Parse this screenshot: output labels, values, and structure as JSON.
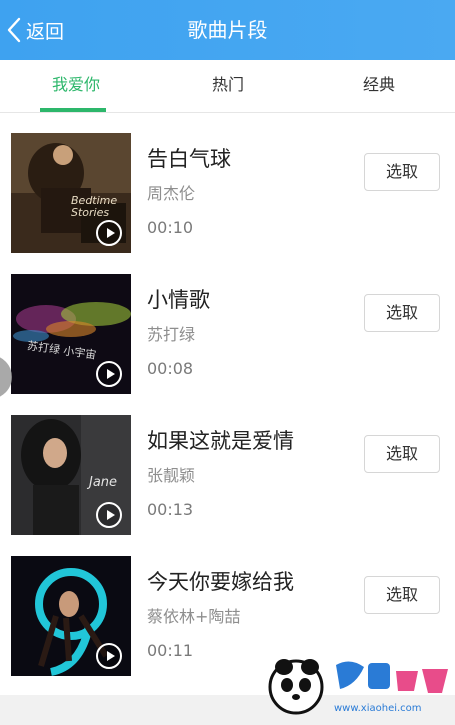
{
  "header": {
    "back_label": "返回",
    "title": "歌曲片段"
  },
  "tabs": [
    {
      "label": "我爱你",
      "active": true
    },
    {
      "label": "热门",
      "active": false
    },
    {
      "label": "经典",
      "active": false
    }
  ],
  "songs": [
    {
      "title": "告白气球",
      "artist": "周杰伦",
      "duration": "00:10",
      "action": "选取",
      "cover_text": "Bedtime Stories"
    },
    {
      "title": "小情歌",
      "artist": "苏打绿",
      "duration": "00:08",
      "action": "选取",
      "cover_text": "苏打绿 小宇宙"
    },
    {
      "title": "如果这就是爱情",
      "artist": "张靓颖",
      "duration": "00:13",
      "action": "选取",
      "cover_text": "Jane"
    },
    {
      "title": "今天你要嫁给我",
      "artist": "蔡依林+陶喆",
      "duration": "00:11",
      "action": "选取",
      "cover_text": ""
    }
  ],
  "watermark": {
    "text": "www.xiaohei.com"
  },
  "colors": {
    "header": "#3ea2f0",
    "tab_active": "#2db76b"
  }
}
